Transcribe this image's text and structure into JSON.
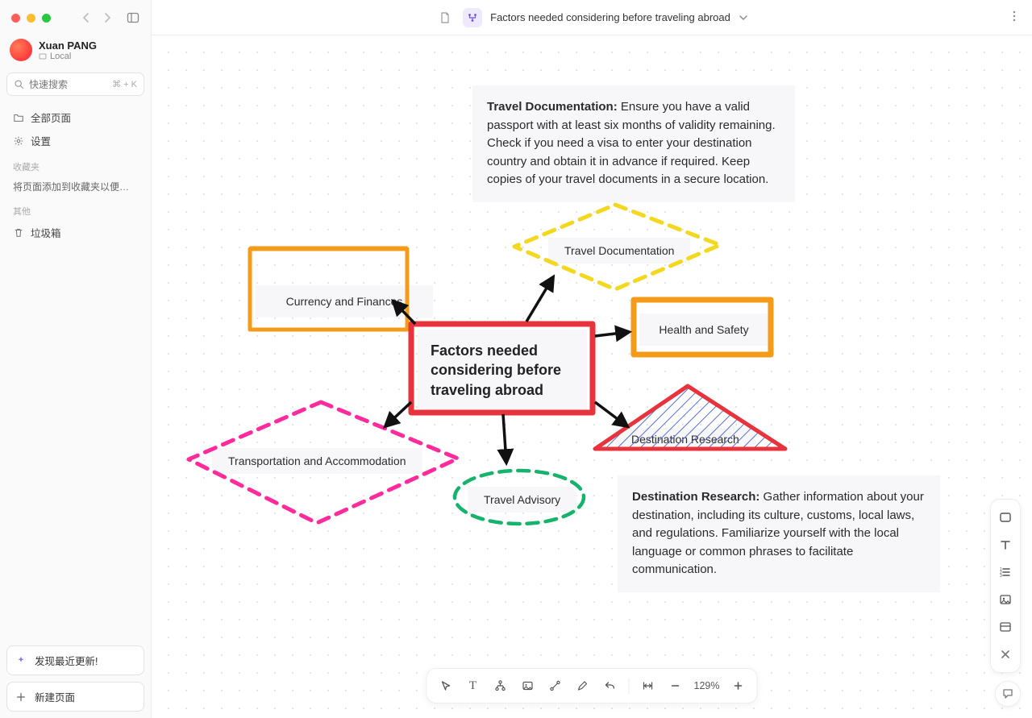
{
  "sidebar": {
    "user_name": "Xuan PANG",
    "user_location": "Local",
    "search_placeholder": "快速搜索",
    "search_shortcut": "⌘ + K",
    "all_pages": "全部页面",
    "settings": "设置",
    "section_favorites": "收藏夹",
    "favorites_hint": "将页面添加到收藏夹以便轻松...",
    "section_other": "其他",
    "trash": "垃圾箱",
    "discover_updates": "发现最近更新!",
    "new_page": "新建页面"
  },
  "topbar": {
    "title": "Factors needed considering before traveling abroad"
  },
  "nodes": {
    "center": "Factors needed considering before traveling abroad",
    "currency": "Currency and Finances",
    "travel_doc": "Travel Documentation",
    "health_safety": "Health and Safety",
    "destination_research": "Destination Research",
    "travel_advisory": "Travel Advisory",
    "transport_accom": "Transportation and Accommodation"
  },
  "notes": {
    "travel_doc_title": "Travel Documentation:",
    "travel_doc_body": " Ensure you have a valid passport with at least six months of validity remaining. Check if you need a visa to enter your destination country and obtain it in advance if required. Keep copies of your travel documents in a secure location.",
    "dest_title": "Destination Research:",
    "dest_body": " Gather information about your destination, including its culture, customs, local laws, and regulations. Familiarize yourself with the local language or common phrases to facilitate communication."
  },
  "toolbar": {
    "zoom_label": "129%"
  },
  "colors": {
    "red": "#e8323c",
    "orange": "#f59b1a",
    "yellow": "#f3d81f",
    "pink": "#ff2b9d",
    "green": "#15b36b",
    "blue_stripe": "#5b6fd4"
  }
}
